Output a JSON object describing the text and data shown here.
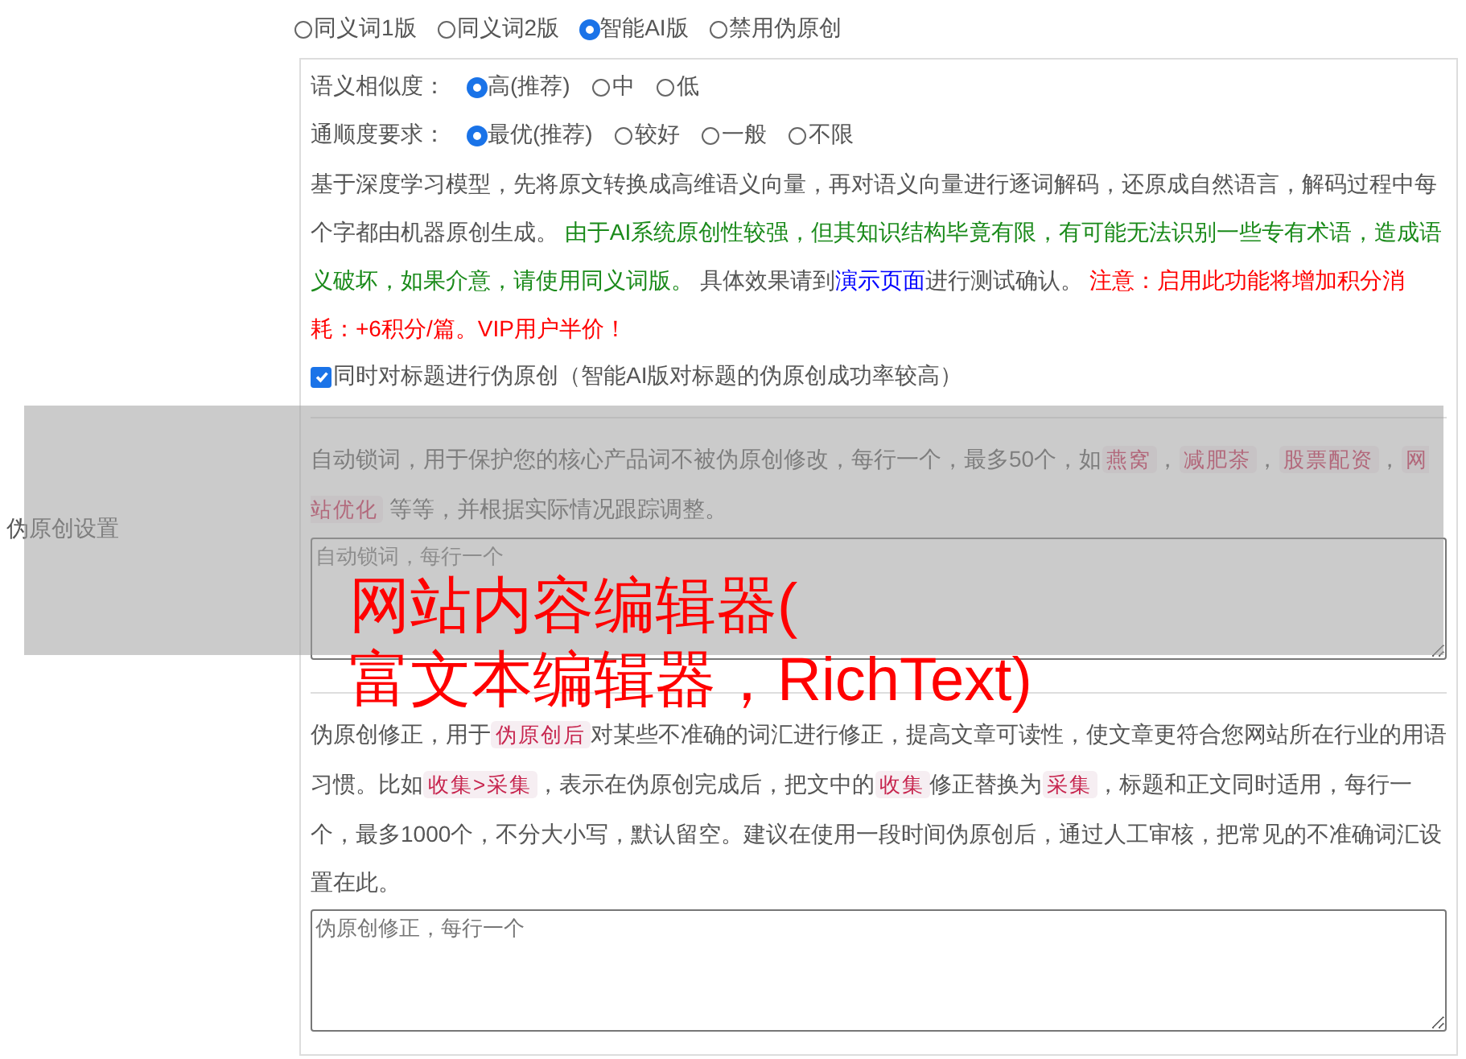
{
  "row_label": "伪原创设置",
  "mode_options": [
    {
      "label": "同义词1版",
      "selected": false
    },
    {
      "label": "同义词2版",
      "selected": false
    },
    {
      "label": "智能AI版",
      "selected": true
    },
    {
      "label": "禁用伪原创",
      "selected": false
    }
  ],
  "similarity": {
    "label": "语义相似度：",
    "options": [
      {
        "label": "高(推荐)",
        "selected": true
      },
      {
        "label": "中",
        "selected": false
      },
      {
        "label": "低",
        "selected": false
      }
    ]
  },
  "fluency": {
    "label": "通顺度要求：",
    "options": [
      {
        "label": "最优(推荐)",
        "selected": true
      },
      {
        "label": "较好",
        "selected": false
      },
      {
        "label": "一般",
        "selected": false
      },
      {
        "label": "不限",
        "selected": false
      }
    ]
  },
  "ai_description": [
    {
      "kind": "plain",
      "text": "基于深度学习模型，先将原文转换成高维语义向量，再对语义向量进行逐词解码，还原成自然语言，解码过程中每个字都由机器原创生成。 "
    },
    {
      "kind": "note",
      "text": "由于AI系统原创性较强，但其知识结构毕竟有限，有可能无法识别一些专有术语，造成语义破坏，如果介意，请使用同义词版。"
    },
    {
      "kind": "plain",
      "text": " 具体效果请到"
    },
    {
      "kind": "link",
      "text": "演示页面"
    },
    {
      "kind": "plain",
      "text": "进行测试确认。 "
    },
    {
      "kind": "warning",
      "text": "注意：启用此功能将增加积分消耗：+6积分/篇。VIP用户半价！"
    }
  ],
  "title_option": {
    "label": "同时对标题进行伪原创（智能AI版对标题的伪原创成功率较高）",
    "checked": true
  },
  "lock_words": {
    "description": [
      {
        "kind": "plain",
        "text": "自动锁词，用于保护您的核心产品词不被伪原创修改，每行一个，最多50个，如"
      },
      {
        "kind": "code",
        "text": "燕窝"
      },
      {
        "kind": "plain",
        "text": "，"
      },
      {
        "kind": "code",
        "text": "减肥茶"
      },
      {
        "kind": "plain",
        "text": "，"
      },
      {
        "kind": "code",
        "text": "股票配资"
      },
      {
        "kind": "plain",
        "text": "，"
      },
      {
        "kind": "code",
        "text": "网站优化"
      },
      {
        "kind": "plain",
        "text": " 等等，并根据实际情况跟踪调整。"
      }
    ],
    "placeholder": "自动锁词，每行一个"
  },
  "corrections": {
    "description": [
      {
        "kind": "plain",
        "text": "伪原创修正，用于"
      },
      {
        "kind": "code",
        "text": "伪原创后"
      },
      {
        "kind": "plain",
        "text": "对某些不准确的词汇进行修正，提高文章可读性，使文章更符合您网站所在行业的用语习惯。比如"
      },
      {
        "kind": "code",
        "text": "收集>采集"
      },
      {
        "kind": "plain",
        "text": "，表示在伪原创完成后，把文中的"
      },
      {
        "kind": "code",
        "text": "收集"
      },
      {
        "kind": "plain",
        "text": "修正替换为"
      },
      {
        "kind": "code",
        "text": "采集"
      },
      {
        "kind": "plain",
        "text": "，标题和正文同时适用，每行一个，最多1000个，不分大小写，默认留空。建议在使用一段时间伪原创后，通过人工审核，把常见的不准确词汇设置在此。"
      }
    ],
    "placeholder": "伪原创修正，每行一个"
  },
  "overlay_banner": {
    "lines": [
      "网站内容编辑器(",
      "富文本编辑器，RichText)"
    ]
  }
}
